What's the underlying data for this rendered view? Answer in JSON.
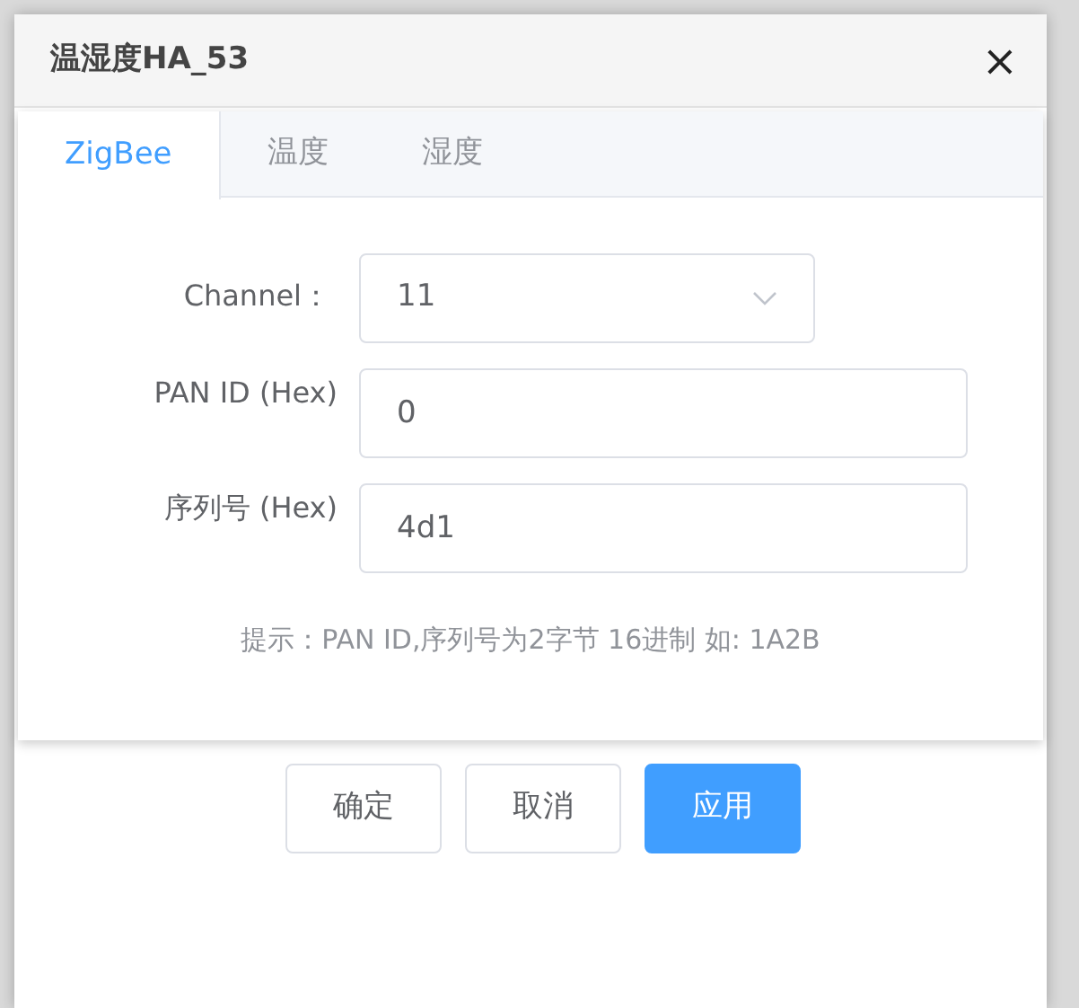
{
  "dialog": {
    "title": "温湿度HA_53",
    "close": "×"
  },
  "tabs": [
    {
      "label": "ZigBee",
      "selected": true
    },
    {
      "label": "温度",
      "selected": false
    },
    {
      "label": "湿度",
      "selected": false
    }
  ],
  "fields": [
    {
      "kind": "select",
      "label": "Channel：",
      "value": "11"
    },
    {
      "kind": "input",
      "label": "PAN ID (Hex)",
      "value": "0"
    },
    {
      "kind": "input",
      "label": "序列号 (Hex)",
      "value": "4d1"
    }
  ],
  "hint": "提示：PAN ID,序列号为2字节 16进制 如: 1A2B",
  "buttons": [
    {
      "label": "确定",
      "kind": "default"
    },
    {
      "label": "取消",
      "kind": "default"
    },
    {
      "label": "应用",
      "kind": "primary"
    }
  ]
}
